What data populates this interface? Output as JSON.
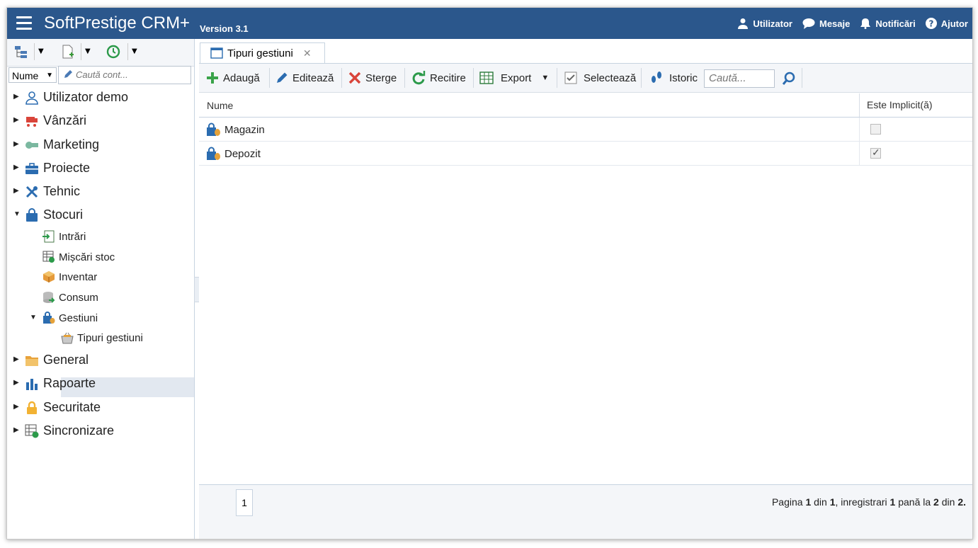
{
  "header": {
    "app_name": "SoftPrestige CRM+",
    "version": "Version 3.1",
    "menu": [
      {
        "label": "Utilizator",
        "icon": "user-icon"
      },
      {
        "label": "Mesaje",
        "icon": "chat-icon"
      },
      {
        "label": "Notificări",
        "icon": "bell-icon"
      },
      {
        "label": "Ajutor",
        "icon": "help-icon"
      }
    ]
  },
  "sidebar": {
    "filter_select": "Nume",
    "search_placeholder": "Caută cont...",
    "tree": {
      "utilizator_demo": "Utilizator demo",
      "vanzari": "Vânzări",
      "marketing": "Marketing",
      "proiecte": "Proiecte",
      "tehnic": "Tehnic",
      "stocuri": "Stocuri",
      "intrari": "Intrări",
      "miscari_stoc": "Mișcări stoc",
      "inventar": "Inventar",
      "consum": "Consum",
      "gestiuni": "Gestiuni",
      "tipuri_gestiuni": "Tipuri gestiuni",
      "general": "General",
      "rapoarte": "Rapoarte",
      "securitate": "Securitate",
      "sincronizare": "Sincronizare"
    }
  },
  "main": {
    "tab_label": "Tipuri gestiuni",
    "toolbar": {
      "add": "Adaugă",
      "edit": "Editează",
      "delete": "Sterge",
      "reload": "Recitire",
      "export": "Export",
      "select": "Selectează",
      "history": "Istoric",
      "search_placeholder": "Caută..."
    },
    "grid": {
      "columns": [
        "Nume",
        "Este Implicit(ă)"
      ],
      "rows": [
        {
          "name": "Magazin",
          "default": false
        },
        {
          "name": "Depozit",
          "default": true
        }
      ]
    },
    "pager": {
      "current_page": "1",
      "info_prefix": "Pagina ",
      "page": "1",
      "din": " din ",
      "pages": "1",
      "records_prefix": ", inregistrari ",
      "from": "1",
      "pana_la": " pană la ",
      "to": "2",
      "din2": " din ",
      "total": "2",
      "end": "."
    }
  },
  "colors": {
    "header_bg": "#2b578c",
    "toolbar_bg": "#f4f6f9",
    "selected_row": "#e2e8f0"
  }
}
